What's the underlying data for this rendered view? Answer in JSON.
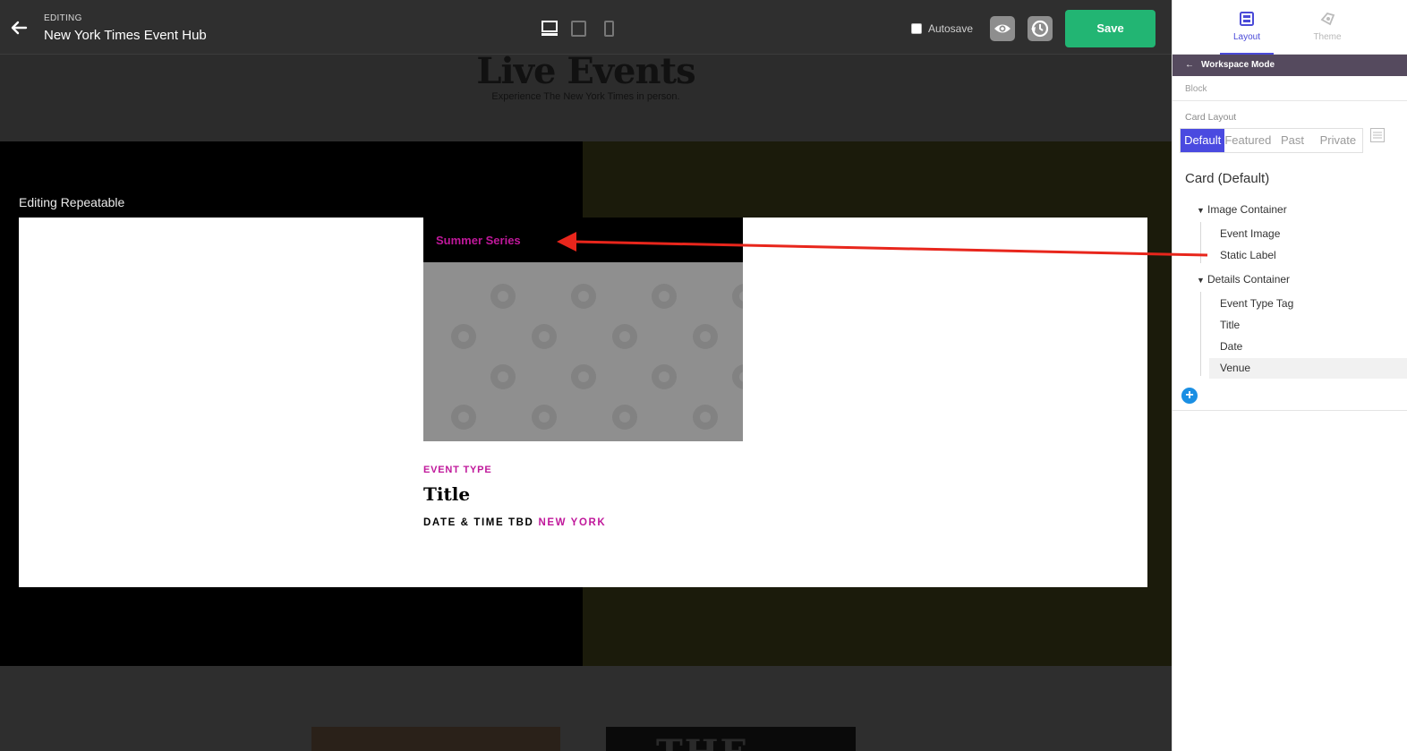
{
  "toolbar": {
    "eyebrow": "EDITING",
    "title": "New York Times Event Hub",
    "autosave_label": "Autosave",
    "save_label": "Save"
  },
  "canvas": {
    "hero_title": "Live Events",
    "hero_subtitle": "Experience The New York Times in person.",
    "editing_label": "Editing Repeatable",
    "card": {
      "static_label": "Summer Series",
      "event_type": "EVENT TYPE",
      "title": "Title",
      "date": "DATE & TIME TBD",
      "venue": "NEW YORK"
    },
    "below_preview_text": "THE"
  },
  "panel": {
    "tabs": [
      {
        "label": "Layout",
        "icon": "layout-icon",
        "active": true
      },
      {
        "label": "Theme",
        "icon": "theme-icon",
        "active": false
      }
    ],
    "workspace_label": "Workspace Mode",
    "block_label": "Block",
    "card_layout_label": "Card Layout",
    "card_layout_options": [
      "Default",
      "Featured",
      "Past",
      "Private"
    ],
    "card_layout_selected": "Default",
    "card_heading": "Card (Default)",
    "tree": [
      {
        "label": "Image Container",
        "group": true
      },
      {
        "label": "Event Image"
      },
      {
        "label": "Static Label"
      },
      {
        "label": "Details Container",
        "group": true
      },
      {
        "label": "Event Type Tag"
      },
      {
        "label": "Title"
      },
      {
        "label": "Date"
      },
      {
        "label": "Venue",
        "selected": true
      }
    ],
    "add_symbol": "+"
  },
  "colors": {
    "accent": "#c0189b",
    "save": "#22b573",
    "tab_active": "#4a4ad8",
    "workspace_bar": "#554a5e",
    "add_button": "#1a8fe3",
    "annotation_arrow": "#e8261c"
  }
}
